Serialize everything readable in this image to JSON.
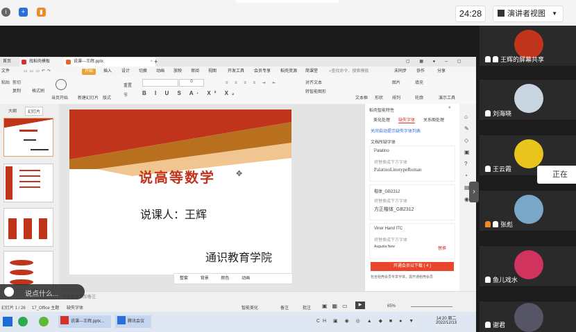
{
  "meeting": {
    "clock": "24:28",
    "view_mode": "演讲者视图",
    "participants": [
      {
        "name": "王辉的屏幕共享"
      },
      {
        "name": "刘海晓"
      },
      {
        "name": "王云霞"
      },
      {
        "name": "张彪"
      },
      {
        "name": "鱼儿戏水"
      },
      {
        "name": "谢君"
      }
    ],
    "speaking_label": "正在",
    "chat_prompt": "说点什么..."
  },
  "wps": {
    "tabs": [
      "首页",
      "找稻壳模板",
      "说课---王辉.pptx"
    ],
    "menu": [
      "文件",
      "开始",
      "插入",
      "设计",
      "切换",
      "动画",
      "放映",
      "审阅",
      "视图",
      "开发工具",
      "会员专享",
      "稻壳资源",
      "简课堂"
    ],
    "search_hint": "查找命令、搜索模板",
    "right_menu": [
      "未同步",
      "协作",
      "分享"
    ],
    "toolbar": {
      "paste": "粘贴",
      "cut": "剪切",
      "copy": "复制",
      "format_painter": "格式刷",
      "from_current": "当页开始",
      "new_slide": "新建幻灯片",
      "layout": "版式",
      "section": "节",
      "reset": "重置",
      "font_size": "0",
      "text_box": "文本框",
      "shape": "形状",
      "arrange": "排列",
      "picture": "图片",
      "fill": "填充",
      "outline": "轮廓",
      "presenter_tools": "演示工具",
      "align_text": "对齐文本",
      "convert_smart": "转智能图形"
    },
    "outline_tabs": [
      "大纲",
      "幻灯片"
    ],
    "slide": {
      "title": "说高等数学",
      "speaker": "说课人：王辉",
      "institution": "通识教育学院"
    },
    "float_toolbar": [
      "整套",
      "背景",
      "颜色",
      "动画"
    ],
    "notes_hint": "单击此处添加备注",
    "right_panel": {
      "title": "稻壳智能特性",
      "tabs": [
        "美化处理",
        "缺失字体",
        "关系图处理"
      ],
      "link": "关闭自动提示缺失字体列表",
      "section": "文档所缺字体",
      "fonts": [
        {
          "name": "Palatino",
          "hint": "将替换成下方字体",
          "replacement": "PalatinoLinotypeRoman"
        },
        {
          "name": "楷体_GB2312",
          "hint": "将替换成下方字体",
          "replacement": "方正楷体_GB2312"
        },
        {
          "name": "Viner Hand ITC",
          "hint": "将替换成下方字体",
          "replacement": "Augusta New",
          "action": "替换"
        }
      ],
      "download_button": "开通会员以下载 ( 4 )",
      "member_note": "包含稻壳会员专享字体，需开通稻壳会员"
    },
    "status": {
      "slide_count": "幻灯片 1 / 26",
      "theme": "17_Office 主题",
      "missing_fonts": "缺失字体",
      "smart_beautify": "智能美化",
      "notes": "备注",
      "comments": "批注",
      "zoom": "65%"
    }
  },
  "taskbar": {
    "apps": [
      "说课---王辉.pptx...",
      "腾讯会议"
    ],
    "time": "14:20 周二",
    "date": "2022/12/13"
  },
  "colors": {
    "accent_orange": "#e0a16a",
    "slide_red": "#c0341c",
    "download_red": "#e8472d",
    "wps_red": "#d1342b"
  }
}
